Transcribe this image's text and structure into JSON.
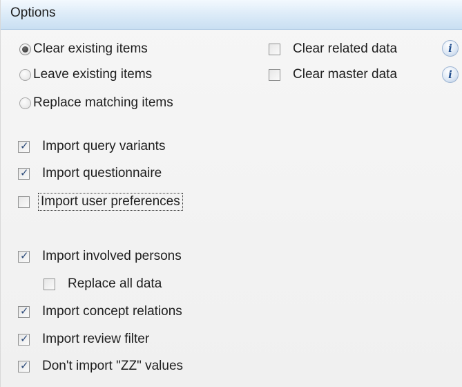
{
  "header": {
    "title": "Options"
  },
  "import_mode": {
    "options": [
      {
        "label": "Clear existing items",
        "checked": true
      },
      {
        "label": "Leave existing items",
        "checked": false
      },
      {
        "label": "Replace matching items",
        "checked": false
      }
    ]
  },
  "clear_options": [
    {
      "label": "Clear related data",
      "checked": false,
      "info_icon": "i"
    },
    {
      "label": "Clear master data",
      "checked": false,
      "info_icon": "i"
    }
  ],
  "checkboxes": {
    "query_variants": {
      "label": "Import query variants",
      "checked": true
    },
    "questionnaire": {
      "label": "Import questionnaire",
      "checked": true
    },
    "user_preferences": {
      "label": "Import user preferences",
      "checked": false
    },
    "involved_persons": {
      "label": "Import involved persons",
      "checked": true
    },
    "replace_all_data": {
      "label": "Replace all data",
      "checked": false
    },
    "concept_relations": {
      "label": "Import concept relations",
      "checked": true
    },
    "review_filter": {
      "label": "Import review filter",
      "checked": true
    },
    "zz_values": {
      "label": "Don't import \"ZZ\" values",
      "checked": true
    }
  },
  "check_glyph": "✓"
}
